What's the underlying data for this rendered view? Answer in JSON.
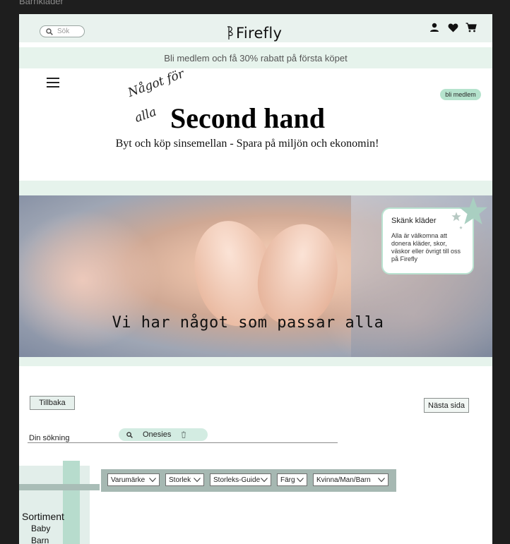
{
  "frame": {
    "title": "Barnkläder"
  },
  "header": {
    "search_placeholder": "Sök",
    "logo_text": "Firefly",
    "icons": [
      "user-icon",
      "heart-icon",
      "cart-icon"
    ]
  },
  "promo": {
    "text": "Bli medlem och få 30% rabatt på första köpet"
  },
  "hero": {
    "script_line1": "Något för",
    "script_line2": "alla",
    "title": "Second hand",
    "subtitle": "Byt och köp sinsemellan - Spara på miljön och ekonomin!",
    "member_button": "bli medlem",
    "caption": "Vi har något som passar alla"
  },
  "donate": {
    "title": "Skänk kläder",
    "text": "Alla är välkomna att donera kläder, skor, väskor eller övrigt till oss på Firefly"
  },
  "nav": {
    "back": "Tillbaka",
    "next": "Nästa sida"
  },
  "search": {
    "label": "Din sökning",
    "query": "Onesies"
  },
  "filters": [
    {
      "label": "Varumärke"
    },
    {
      "label": "Storlek"
    },
    {
      "label": "Storleks-Guide"
    },
    {
      "label": "Färg"
    },
    {
      "label": "Kvinna/Man/Barn"
    }
  ],
  "sidebar": {
    "title": "Sortiment",
    "items": [
      "Baby",
      "Barn"
    ]
  },
  "colors": {
    "mint": "#e6f3ec",
    "accent": "#b5e3cd",
    "filter_bar": "#a6b8b2"
  }
}
